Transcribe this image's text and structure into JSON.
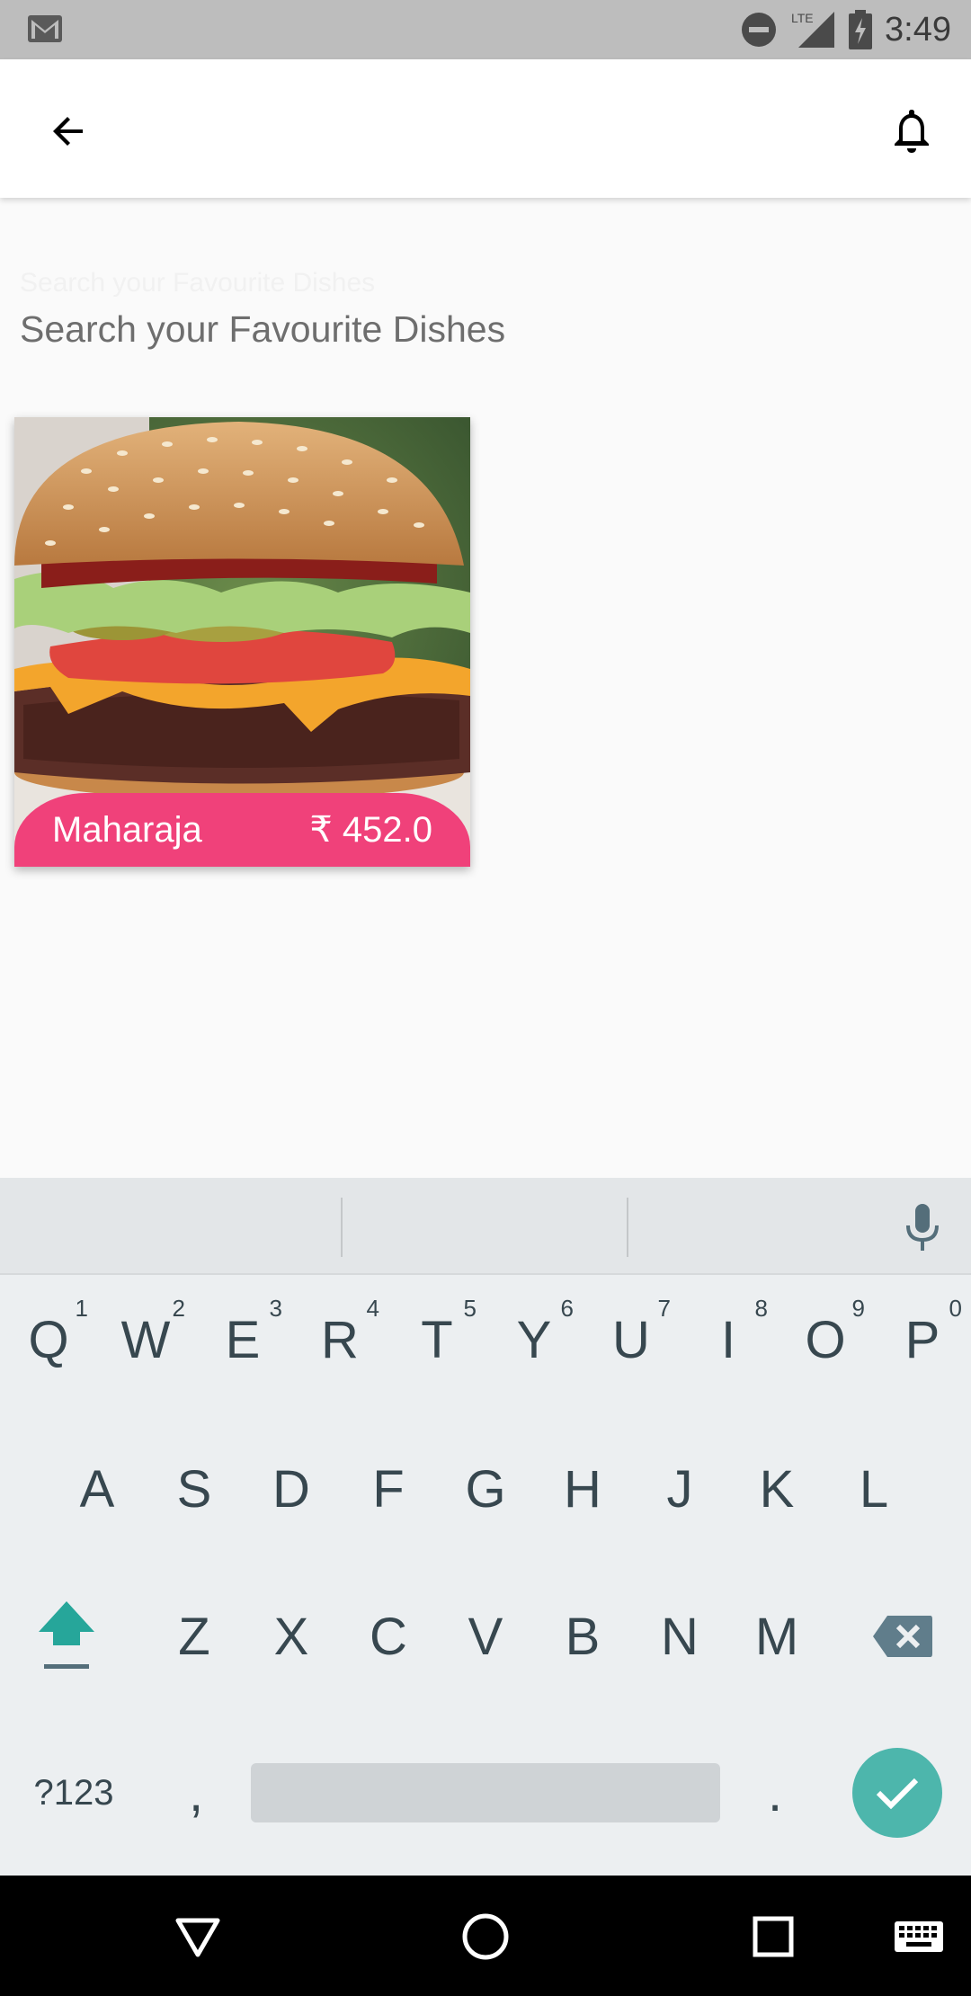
{
  "status_bar": {
    "time": "3:49",
    "icons": [
      "gmail-icon",
      "dnd-icon",
      "lte-signal-icon",
      "battery-charging-icon"
    ],
    "network": "LTE"
  },
  "app_bar": {
    "back_icon": "arrow-left-icon",
    "notification_icon": "bell-icon"
  },
  "search": {
    "floating_label": "Search your Favourite Dishes",
    "placeholder": "Search your Favourite Dishes",
    "value": ""
  },
  "dishes": [
    {
      "name": "Maharaja",
      "price": "₹ 452.0",
      "image": "burger"
    }
  ],
  "colors": {
    "accent": "#f0417a",
    "keyboard_action": "#4db6ac",
    "status_bar": "#bdbdbd"
  },
  "keyboard": {
    "row1": [
      {
        "key": "Q",
        "hint": "1"
      },
      {
        "key": "W",
        "hint": "2"
      },
      {
        "key": "E",
        "hint": "3"
      },
      {
        "key": "R",
        "hint": "4"
      },
      {
        "key": "T",
        "hint": "5"
      },
      {
        "key": "Y",
        "hint": "6"
      },
      {
        "key": "U",
        "hint": "7"
      },
      {
        "key": "I",
        "hint": "8"
      },
      {
        "key": "O",
        "hint": "9"
      },
      {
        "key": "P",
        "hint": "0"
      }
    ],
    "row2": [
      "A",
      "S",
      "D",
      "F",
      "G",
      "H",
      "J",
      "K",
      "L"
    ],
    "row3": [
      "Z",
      "X",
      "C",
      "V",
      "B",
      "N",
      "M"
    ],
    "symbols_label": "?123",
    "comma_label": ",",
    "period_label": "."
  }
}
